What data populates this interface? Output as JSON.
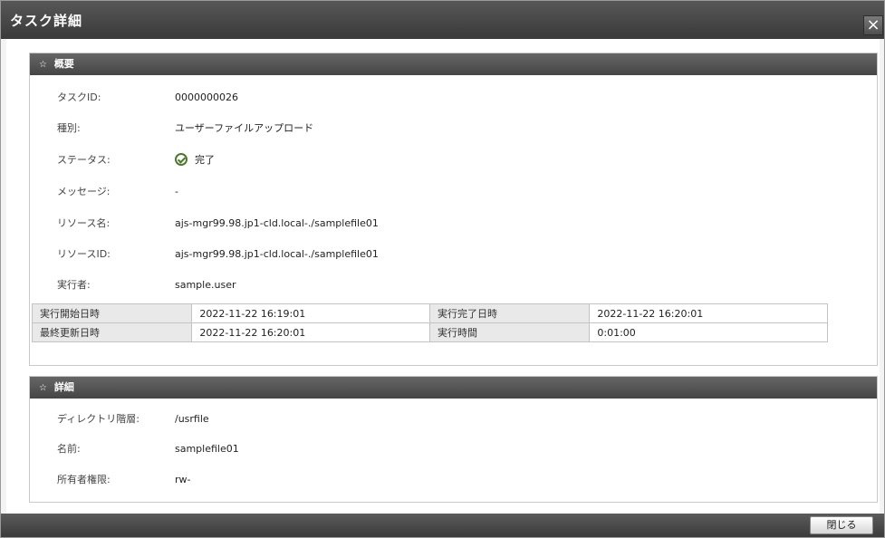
{
  "dialog": {
    "title": "タスク詳細",
    "close_glyph": "×",
    "close_icon": "close-icon"
  },
  "overview": {
    "header": "概要",
    "chevron_glyph": "☆",
    "fields": [
      {
        "label": "タスクID:",
        "value": "0000000026"
      },
      {
        "label": "種別:",
        "value": "ユーザーファイルアップロード"
      },
      {
        "label": "ステータス:",
        "value": "完了",
        "icon": "check-circle-icon",
        "icon_color": "#4a7a2a"
      },
      {
        "label": "メッセージ:",
        "value": "-"
      },
      {
        "label": "リソース名:",
        "value": "ajs-mgr99.98.jp1-cld.local-./samplefile01"
      },
      {
        "label": "リソースID:",
        "value": "ajs-mgr99.98.jp1-cld.local-./samplefile01"
      },
      {
        "label": "実行者:",
        "value": "sample.user"
      }
    ],
    "times": {
      "start_label": "実行開始日時",
      "start_value": "2022-11-22 16:19:01",
      "end_label": "実行完了日時",
      "end_value": "2022-11-22 16:20:01",
      "updated_label": "最終更新日時",
      "updated_value": "2022-11-22 16:20:01",
      "duration_label": "実行時間",
      "duration_value": "0:01:00"
    }
  },
  "details": {
    "header": "詳細",
    "chevron_glyph": "☆",
    "fields": [
      {
        "label": "ディレクトリ階層:",
        "value": "/usrfile"
      },
      {
        "label": "名前:",
        "value": "samplefile01"
      },
      {
        "label": "所有者権限:",
        "value": "rw-"
      }
    ]
  },
  "footer": {
    "close_label": "閉じる"
  },
  "colors": {
    "title_bar": "#3f3f3f",
    "panel_header": "#555555",
    "status_ok": "#4a7a2a"
  }
}
